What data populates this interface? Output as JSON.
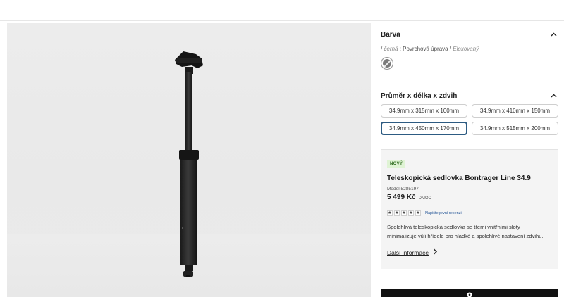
{
  "color_section": {
    "title": "Barva",
    "prefix": "/ ",
    "color_name": "černá",
    "separator": " ; ",
    "finish_label": "Povrchová úprava",
    "slash": " / ",
    "finish_value": "Eloxovaný",
    "swatch_color": "#7a7a7a"
  },
  "size_section": {
    "title": "Průměr x délka x zdvih",
    "options": [
      "34.9mm x 315mm x 100mm",
      "34.9mm x 410mm x 150mm",
      "34.9mm x 450mm x 170mm",
      "34.9mm x 515mm x 200mm"
    ],
    "selected": "34.9mm x 450mm x 170mm"
  },
  "product": {
    "badge": "NOVÝ",
    "name": "Teleskopická sedlovka Bontrager Line 34.9",
    "model": "Model 5285197",
    "price": "5 499 Kč",
    "price_note": "DMOC",
    "stars": [
      "★",
      "★",
      "★",
      "★",
      "★"
    ],
    "review_link": "Napište první recenzi.",
    "description": "Spolehlivá teleskopická sedlovka se třemi vnitřními sloty minimalizuje vůli hřídele pro hladké a spolehlivé nastavení zdvihu.",
    "more_link": "Další informace"
  },
  "colors": {
    "selected_border": "#2d5b82",
    "badge_bg": "#dff3d4",
    "cta_bg": "#111111"
  }
}
